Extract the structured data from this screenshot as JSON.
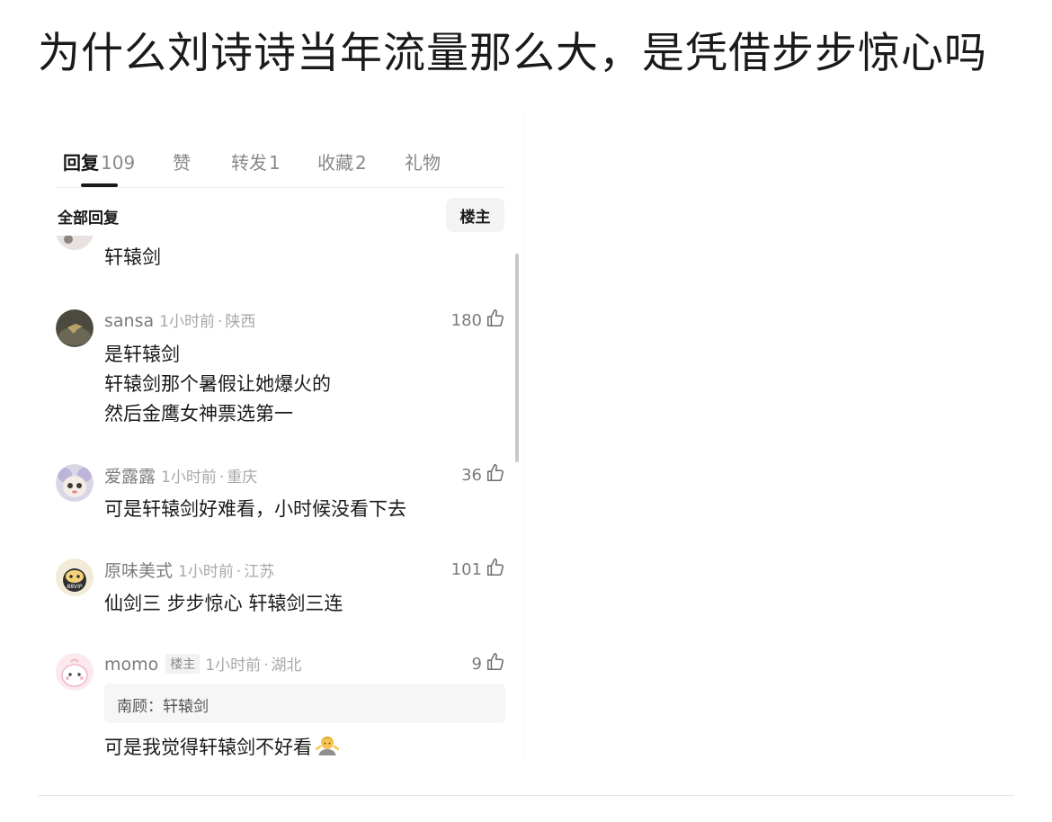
{
  "post": {
    "title": "为什么刘诗诗当年流量那么大，是凭借步步惊心吗"
  },
  "tabs": [
    {
      "label": "回复",
      "count": "109",
      "active": true
    },
    {
      "label": "赞",
      "count": ""
    },
    {
      "label": "转发",
      "count": "1"
    },
    {
      "label": "收藏",
      "count": "2"
    },
    {
      "label": "礼物",
      "count": ""
    }
  ],
  "sub_header": {
    "all_replies": "全部回复",
    "owner_filter": "楼主"
  },
  "comments": [
    {
      "author": "",
      "time": "",
      "location": "",
      "likes": "",
      "lines": [
        "轩辕剑"
      ]
    },
    {
      "author": "sansa",
      "time": "1小时前",
      "location": "陕西",
      "likes": "180",
      "lines": [
        "是轩辕剑",
        "轩辕剑那个暑假让她爆火的",
        "然后金鹰女神票选第一"
      ]
    },
    {
      "author": "爱露露",
      "time": "1小时前",
      "location": "重庆",
      "likes": "36",
      "lines": [
        "可是轩辕剑好难看，小时候没看下去"
      ]
    },
    {
      "author": "原味美式",
      "time": "1小时前",
      "location": "江苏",
      "likes": "101",
      "avatar_text": "88VIP",
      "lines": [
        "仙剑三 步步惊心 轩辕剑三连"
      ]
    },
    {
      "author": "momo",
      "owner_tag": "楼主",
      "time": "1小时前",
      "location": "湖北",
      "likes": "9",
      "quote": "南顾：轩辕剑",
      "lines": [
        "可是我觉得轩辕剑不好看"
      ],
      "emoji": "person-shrugging-emoji"
    }
  ],
  "icons": [
    "thumb-up-icon"
  ],
  "colors": {
    "text_primary": "#1a1a1a",
    "text_secondary": "#7b7b7b",
    "text_muted": "#a8a8a8"
  }
}
